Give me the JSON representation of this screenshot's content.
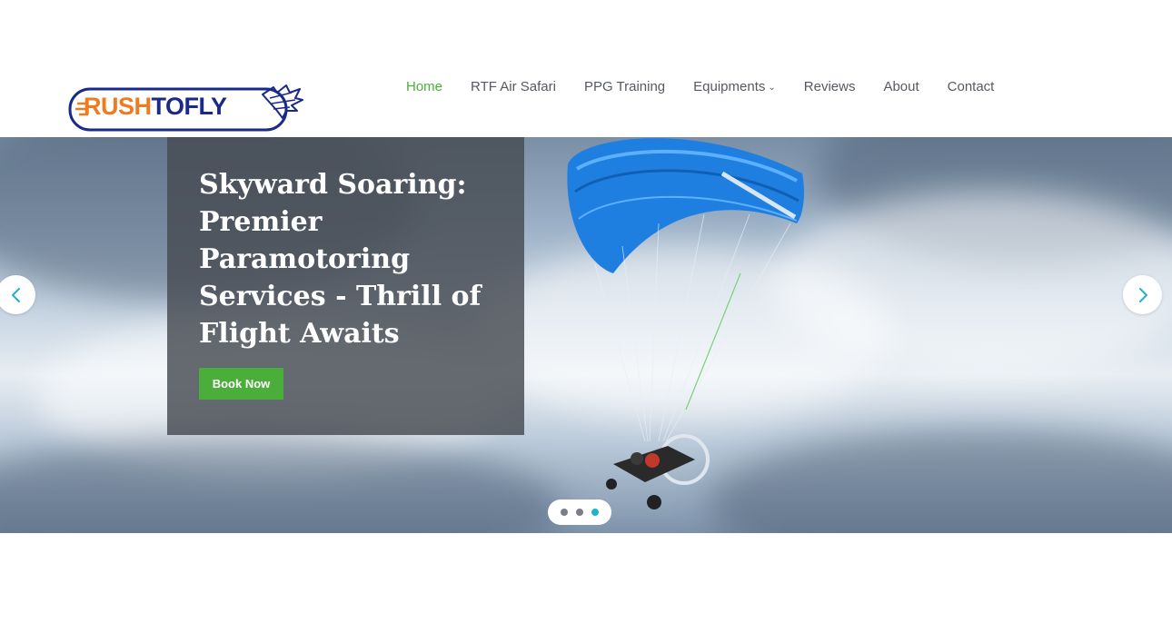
{
  "brand": {
    "logo_text_part1": "RUSH",
    "logo_text_part2": "TOFLY",
    "colors": {
      "orange": "#f07a1f",
      "navy": "#1a2a8a"
    }
  },
  "nav": {
    "items": [
      {
        "label": "Home",
        "active": true
      },
      {
        "label": "RTF Air Safari",
        "active": false
      },
      {
        "label": "PPG Training",
        "active": false
      },
      {
        "label": "Equipments",
        "active": false,
        "has_dropdown": true
      },
      {
        "label": "Reviews",
        "active": false
      },
      {
        "label": "About",
        "active": false
      },
      {
        "label": "Contact",
        "active": false
      }
    ],
    "dropdown_caret": "⌄",
    "colors": {
      "active": "#4cae3a",
      "default": "#555a60"
    }
  },
  "hero": {
    "title": "Skyward Soaring: Premier Paramotoring Services - Thrill of Flight Awaits",
    "cta_label": "Book Now",
    "prev_icon": "chevron-left-icon",
    "next_icon": "chevron-right-icon",
    "slides_count": 3,
    "active_slide": 3,
    "colors": {
      "cta": "#4cae3a",
      "arrow": "#1fb3c9",
      "dot_active": "#1fb3c9",
      "dot": "#7b7f85"
    }
  }
}
